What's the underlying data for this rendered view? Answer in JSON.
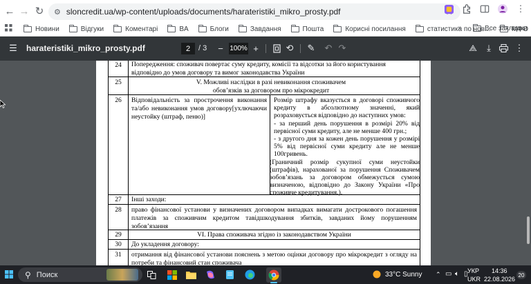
{
  "browser": {
    "url": "sloncredit.ua/wp-content/uploads/documents/harateristiki_mikro_prosty.pdf",
    "bookmarks": [
      "Новини",
      "Відгуки",
      "Коментарі",
      "BA",
      "Блоги",
      "Завдання",
      "Пошта",
      "Корисні посилання",
      "статистика по нов...",
      "МФО"
    ],
    "all_bookmarks": "Все закладки"
  },
  "pdf": {
    "filename": "harateristiki_mikro_prosty.pdf",
    "page": "2",
    "page_total": "/ 3",
    "zoom": "100%"
  },
  "document": {
    "r24_num": "24",
    "r24_text": "Попередження: споживач повертає суму кредиту, комісії та відсотки за його користування відповідно до умов договору та вимог законодавства України",
    "r25_num": "25",
    "r25_text": "V. Можливі наслідки в разі невиконання споживачем обов’язків за договором про мікрокредит",
    "r26_num": "26",
    "r26_left": "Відповідальність за прострочення виконання та/або невиконання умов договору[ухлючаючи неустойку (штраф, пеню)]",
    "r26_right_1": "Розмір штрафу вказується в договорі споживчого кредиту в абсолютному значенні, який розраховується відповідно до наступних умов:",
    "r26_right_2": "- за перший день порушення в розмірі 20% від первісної суми кредиту, але не менше 400 грн.;",
    "r26_right_3": "- з другого дня за кожен день порушення у розмірі 5% від первісної суми кредиту але не менше 100гривень.",
    "r26_right_4": "(Граничний розмір сукупної суми неустойки (штрафів), нарахованої за порушення Споживачем зобов’язань за договором обмежується сумою визначеною, відповідно до Закону України «Про споживче кредитування.).",
    "r27_num": "27",
    "r27_text": "Інші заходи:",
    "r28_num": "28",
    "r28_text": "право фінансової установи у визначених договором випадках вимагати дострокового погашення платежів за споживчим кредитом тавідшкодування збитків, завданих йому порушенням зобов’язання",
    "r29_num": "29",
    "r29_text": "VI. Права споживача згідно із законодавством України",
    "r30_num": "30",
    "r30_text": "До укладення договору:",
    "r31_num": "31",
    "r31_text": "отримання від фінансової установи пояснень з метою оцінки договору про мікрокредит з огляду на потреби та фінансовий стан споживача"
  },
  "taskbar": {
    "search_placeholder": "Поиск",
    "weather": "33°C  Sunny",
    "lang_1": "УКР",
    "lang_2": "UKR",
    "time": "14:36",
    "date": "22.08.2026",
    "notif_count": "20"
  },
  "colors": {
    "pdf_bg": "#525659",
    "toolbar": "#323639",
    "taskbar": "#1f2126"
  }
}
